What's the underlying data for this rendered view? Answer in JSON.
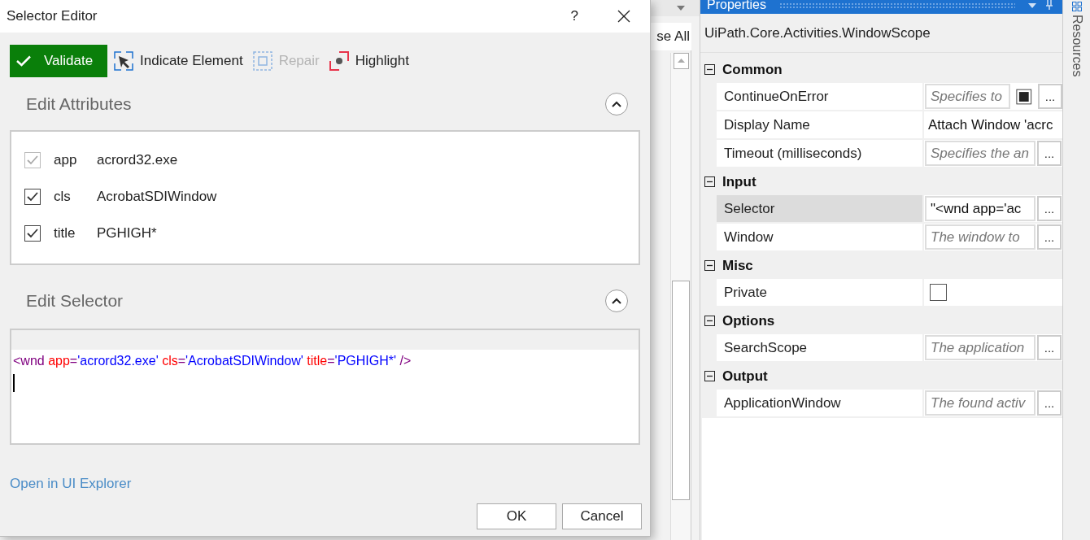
{
  "dialog": {
    "title": "Selector Editor",
    "help": "?",
    "toolbar": [
      {
        "label": "Validate",
        "kind": "primary",
        "disabled": false
      },
      {
        "label": "Indicate Element",
        "kind": "indicate",
        "disabled": false
      },
      {
        "label": "Repair",
        "kind": "repair",
        "disabled": true
      },
      {
        "label": "Highlight",
        "kind": "highlight",
        "disabled": false
      }
    ],
    "attributes_section": {
      "title": "Edit Attributes",
      "expanded": true,
      "rows": [
        {
          "name": "app",
          "value": "acrord32.exe",
          "checked": true,
          "disabled": true
        },
        {
          "name": "cls",
          "value": "AcrobatSDIWindow",
          "checked": true,
          "disabled": false
        },
        {
          "name": "title",
          "value": "PGHIGH*",
          "checked": true,
          "disabled": false
        }
      ]
    },
    "selector_section": {
      "title": "Edit Selector",
      "expanded": true,
      "tokens": [
        {
          "text": "<wnd ",
          "kind": "tag"
        },
        {
          "text": "app",
          "kind": "attr"
        },
        {
          "text": "=",
          "kind": "tag"
        },
        {
          "text": "'acrord32.exe' ",
          "kind": "value"
        },
        {
          "text": "cls",
          "kind": "attr"
        },
        {
          "text": "=",
          "kind": "tag"
        },
        {
          "text": "'AcrobatSDIWindow' ",
          "kind": "value"
        },
        {
          "text": "title",
          "kind": "attr"
        },
        {
          "text": "=",
          "kind": "tag"
        },
        {
          "text": "'PGHIGH*'",
          "kind": "value"
        },
        {
          "text": " />",
          "kind": "tag"
        }
      ]
    },
    "link": "Open in UI Explorer",
    "buttons": [
      "OK",
      "Cancel"
    ]
  },
  "background_panel": {
    "button_text": "se All"
  },
  "properties": {
    "title": "Properties",
    "type_name": "UiPath.Core.Activities.WindowScope",
    "categories": [
      {
        "name": "Common",
        "expanded": true,
        "rows": [
          {
            "name": "ContinueOnError",
            "placeholder": "Specifies to",
            "kind": "field_toggle",
            "selected": false,
            "button": "..."
          },
          {
            "name": "Display Name",
            "value": "Attach Window 'acrc",
            "kind": "text",
            "selected": false
          },
          {
            "name": "Timeout (milliseconds)",
            "placeholder": "Specifies the an",
            "kind": "field",
            "selected": false,
            "button": "..."
          }
        ]
      },
      {
        "name": "Input",
        "expanded": true,
        "rows": [
          {
            "name": "Selector",
            "value": "\"<wnd app='ac",
            "kind": "field",
            "selected": true,
            "button": "..."
          },
          {
            "name": "Window",
            "placeholder": "The window to",
            "kind": "field",
            "selected": false,
            "button": "..."
          }
        ]
      },
      {
        "name": "Misc",
        "expanded": true,
        "rows": [
          {
            "name": "Private",
            "kind": "checkbox",
            "checked": false,
            "selected": false
          }
        ]
      },
      {
        "name": "Options",
        "expanded": true,
        "rows": [
          {
            "name": "SearchScope",
            "placeholder": "The application",
            "kind": "field",
            "selected": false,
            "button": "..."
          }
        ]
      },
      {
        "name": "Output",
        "expanded": true,
        "rows": [
          {
            "name": "ApplicationWindow",
            "placeholder": "The found activ",
            "kind": "field",
            "selected": false,
            "button": "..."
          }
        ]
      }
    ]
  },
  "side_tab": "Resources"
}
